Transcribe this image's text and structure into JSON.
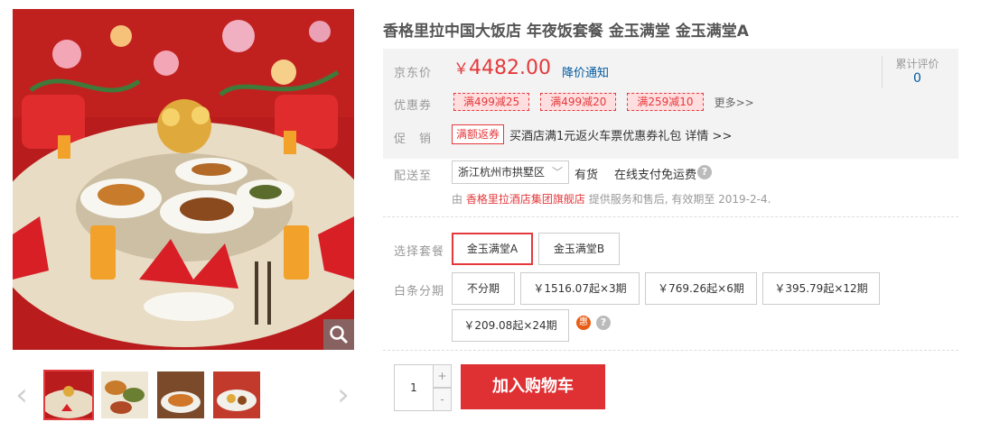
{
  "gallery": {
    "zoom_icon": "magnifier-icon",
    "prev_icon": "chevron-left-icon",
    "next_icon": "chevron-right-icon",
    "thumbnail_count": 4,
    "active_thumbnail": 1
  },
  "product": {
    "title": "香格里拉中国大饭店 年夜饭套餐 金玉满堂 金玉满堂A"
  },
  "price": {
    "label": "京东价",
    "currency": "￥",
    "amount": "4482.00",
    "notify_link": "降价通知",
    "color": "#e4393c"
  },
  "review": {
    "label": "累计评价",
    "count": "0"
  },
  "coupons": {
    "label": "优惠券",
    "items": [
      "满499减25",
      "满499减20",
      "满259减10"
    ],
    "more": "更多>>"
  },
  "promotion": {
    "label": "促　销",
    "tag": "满额返券",
    "text": "买酒店满1元返火车票优惠券礼包 详情 >>"
  },
  "delivery": {
    "label": "配送至",
    "location": "浙江杭州市拱墅区",
    "stock": "有货",
    "pay_info": "在线支付免运费",
    "shop_prefix": "由",
    "shop_name": "香格里拉酒店集团旗舰店",
    "shop_suffix": "提供服务和售后, 有效期至 2019-2-4."
  },
  "sets": {
    "label": "选择套餐",
    "options": [
      "金玉满堂A",
      "金玉满堂B"
    ],
    "selected": "金玉满堂A"
  },
  "installment": {
    "label": "白条分期",
    "options": [
      "不分期",
      "￥1516.07起×3期",
      "￥769.26起×6期",
      "￥395.79起×12期",
      "￥209.08起×24期"
    ],
    "hui_badge": "惠"
  },
  "cart": {
    "quantity": "1",
    "plus": "+",
    "minus": "-",
    "button": "加入购物车",
    "button_color": "#df3033"
  }
}
